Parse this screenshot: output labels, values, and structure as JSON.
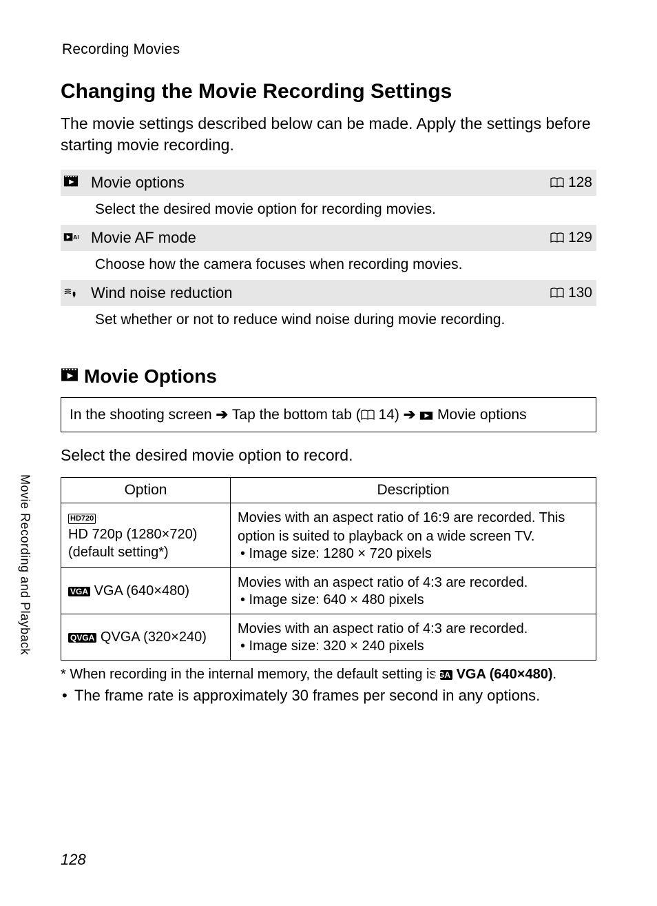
{
  "header": "Recording Movies",
  "mainHeading": "Changing the Movie Recording Settings",
  "intro": "The movie settings described below can be made. Apply the settings before starting movie recording.",
  "settings": [
    {
      "title": "Movie options",
      "page": "128",
      "desc": "Select the desired movie option for recording movies."
    },
    {
      "title": "Movie AF mode",
      "page": "129",
      "desc": "Choose how the camera focuses when recording movies."
    },
    {
      "title": "Wind noise reduction",
      "page": "130",
      "desc": "Set whether or not to reduce wind noise during movie recording."
    }
  ],
  "subHeading": "Movie Options",
  "navBox": {
    "part1": "In the shooting screen",
    "part2": "Tap the bottom tab (",
    "partPage": "14)",
    "part3": "Movie options"
  },
  "lead": "Select the desired movie option to record.",
  "table": {
    "headOption": "Option",
    "headDesc": "Description",
    "rows": [
      {
        "badge": "HD720",
        "badgeType": "outline",
        "label": "HD 720p (1280×720)\n(default setting*)",
        "desc": "Movies with an aspect ratio of 16:9 are recorded. This option is suited to playback on a wide screen TV.",
        "bullet": "Image size: 1280 × 720 pixels"
      },
      {
        "badge": "VGA",
        "badgeType": "solid",
        "label": "VGA (640×480)",
        "desc": "Movies with an aspect ratio of 4:3 are recorded.",
        "bullet": "Image size: 640 × 480 pixels"
      },
      {
        "badge": "QVGA",
        "badgeType": "solid",
        "label": "QVGA (320×240)",
        "desc": "Movies with an aspect ratio of 4:3 are recorded.",
        "bullet": "Image size: 320 × 240 pixels"
      }
    ]
  },
  "footnote": {
    "prefix": "*  When recording in the internal memory, the default setting is ",
    "badge": "VGA",
    "bold": "VGA (640×480)",
    "suffix": "."
  },
  "noteBullet": "The frame rate is approximately 30 frames per second in any options.",
  "sideTab": "Movie Recording and Playback",
  "pageNumber": "128"
}
